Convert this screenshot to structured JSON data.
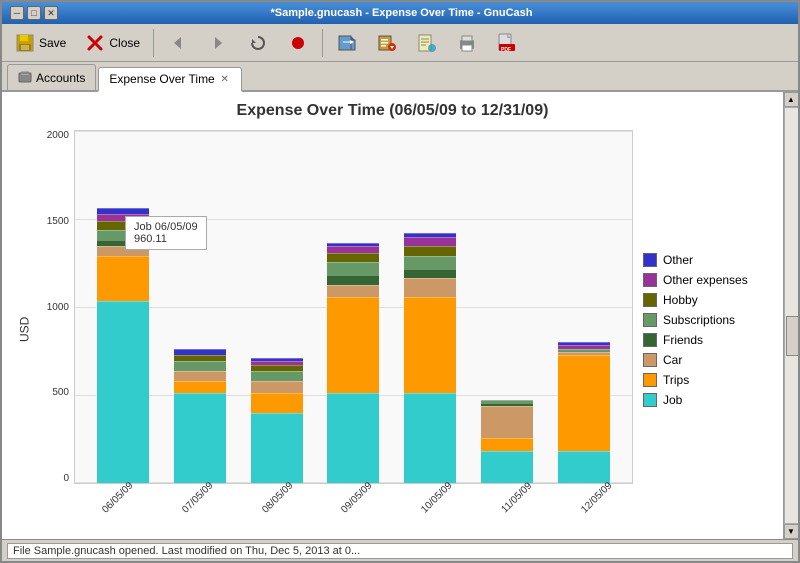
{
  "window": {
    "title": "*Sample.gnucash - Expense Over Time - GnuCash",
    "controls": [
      "minimize",
      "restore",
      "close"
    ]
  },
  "toolbar": {
    "buttons": [
      {
        "id": "save",
        "label": "Save",
        "icon": "save-icon"
      },
      {
        "id": "close",
        "label": "Close",
        "icon": "close-icon"
      },
      {
        "id": "back",
        "label": "",
        "icon": "back-icon"
      },
      {
        "id": "forward",
        "label": "",
        "icon": "forward-icon"
      },
      {
        "id": "refresh",
        "label": "",
        "icon": "refresh-icon"
      },
      {
        "id": "record",
        "label": "",
        "icon": "record-icon"
      },
      {
        "id": "import",
        "label": "",
        "icon": "import-icon"
      },
      {
        "id": "export",
        "label": "",
        "icon": "export-icon"
      },
      {
        "id": "report",
        "label": "",
        "icon": "report-icon"
      },
      {
        "id": "print",
        "label": "",
        "icon": "print-icon"
      },
      {
        "id": "pdf",
        "label": "",
        "icon": "pdf-icon"
      }
    ]
  },
  "tabs": [
    {
      "id": "accounts",
      "label": "Accounts",
      "icon": "accounts-icon",
      "closable": false,
      "active": false
    },
    {
      "id": "expense-over-time",
      "label": "Expense Over Time",
      "icon": null,
      "closable": true,
      "active": true
    }
  ],
  "chart": {
    "title": "Expense Over Time (06/05/09 to 12/31/09)",
    "y_axis_label": "USD",
    "y_ticks": [
      "2000",
      "1500",
      "1000",
      "500",
      "0"
    ],
    "x_ticks": [
      "06/05/09",
      "07/05/09",
      "08/05/09",
      "09/05/09",
      "10/05/09",
      "11/05/09",
      "12/05/09"
    ],
    "tooltip": {
      "line1": "Job 06/05/09",
      "line2": "960.11"
    },
    "legend": [
      {
        "label": "Other",
        "color": "#3333cc"
      },
      {
        "label": "Other expenses",
        "color": "#993399"
      },
      {
        "label": "Hobby",
        "color": "#666600"
      },
      {
        "label": "Subscriptions",
        "color": "#669966"
      },
      {
        "label": "Friends",
        "color": "#336633"
      },
      {
        "label": "Car",
        "color": "#cc9966"
      },
      {
        "label": "Trips",
        "color": "#ff9900"
      },
      {
        "label": "Job",
        "color": "#33cccc"
      }
    ],
    "bars": [
      {
        "x": "06/05/09",
        "segments": [
          {
            "category": "Job",
            "color": "#33cccc",
            "height_pct": 57
          },
          {
            "category": "Trips",
            "color": "#ff9900",
            "height_pct": 14
          },
          {
            "category": "Car",
            "color": "#cc9966",
            "height_pct": 3
          },
          {
            "category": "Friends",
            "color": "#336633",
            "height_pct": 2
          },
          {
            "category": "Subscriptions",
            "color": "#669966",
            "height_pct": 3
          },
          {
            "category": "Hobby",
            "color": "#666600",
            "height_pct": 3
          },
          {
            "category": "Other expenses",
            "color": "#993399",
            "height_pct": 2
          },
          {
            "category": "Other",
            "color": "#3333cc",
            "height_pct": 2
          }
        ],
        "total_pct": 86
      },
      {
        "x": "07/05/09",
        "segments": [
          {
            "category": "Job",
            "color": "#33cccc",
            "height_pct": 28
          },
          {
            "category": "Trips",
            "color": "#ff9900",
            "height_pct": 4
          },
          {
            "category": "Car",
            "color": "#cc9966",
            "height_pct": 3
          },
          {
            "category": "Subscriptions",
            "color": "#669966",
            "height_pct": 3
          },
          {
            "category": "Hobby",
            "color": "#666600",
            "height_pct": 2
          },
          {
            "category": "Other",
            "color": "#3333cc",
            "height_pct": 2
          }
        ],
        "total_pct": 42
      },
      {
        "x": "08/05/09",
        "segments": [
          {
            "category": "Job",
            "color": "#33cccc",
            "height_pct": 22
          },
          {
            "category": "Trips",
            "color": "#ff9900",
            "height_pct": 6
          },
          {
            "category": "Car",
            "color": "#cc9966",
            "height_pct": 4
          },
          {
            "category": "Subscriptions",
            "color": "#669966",
            "height_pct": 3
          },
          {
            "category": "Hobby",
            "color": "#666600",
            "height_pct": 2
          },
          {
            "category": "Other expenses",
            "color": "#993399",
            "height_pct": 1
          },
          {
            "category": "Other",
            "color": "#3333cc",
            "height_pct": 1
          }
        ],
        "total_pct": 32
      },
      {
        "x": "09/05/09",
        "segments": [
          {
            "category": "Job",
            "color": "#33cccc",
            "height_pct": 28
          },
          {
            "category": "Trips",
            "color": "#ff9900",
            "height_pct": 30
          },
          {
            "category": "Car",
            "color": "#cc9966",
            "height_pct": 4
          },
          {
            "category": "Friends",
            "color": "#336633",
            "height_pct": 3
          },
          {
            "category": "Subscriptions",
            "color": "#669966",
            "height_pct": 4
          },
          {
            "category": "Hobby",
            "color": "#666600",
            "height_pct": 3
          },
          {
            "category": "Other expenses",
            "color": "#993399",
            "height_pct": 2
          },
          {
            "category": "Other",
            "color": "#3333cc",
            "height_pct": 1
          }
        ],
        "total_pct": 75
      },
      {
        "x": "10/05/09",
        "segments": [
          {
            "category": "Job",
            "color": "#33cccc",
            "height_pct": 28
          },
          {
            "category": "Trips",
            "color": "#ff9900",
            "height_pct": 30
          },
          {
            "category": "Car",
            "color": "#cc9966",
            "height_pct": 6
          },
          {
            "category": "Friends",
            "color": "#336633",
            "height_pct": 3
          },
          {
            "category": "Subscriptions",
            "color": "#669966",
            "height_pct": 4
          },
          {
            "category": "Hobby",
            "color": "#666600",
            "height_pct": 3
          },
          {
            "category": "Other expenses",
            "color": "#993399",
            "height_pct": 3
          },
          {
            "category": "Other",
            "color": "#3333cc",
            "height_pct": 1
          }
        ],
        "total_pct": 78
      },
      {
        "x": "11/05/09",
        "segments": [
          {
            "category": "Job",
            "color": "#33cccc",
            "height_pct": 10
          },
          {
            "category": "Trips",
            "color": "#ff9900",
            "height_pct": 4
          },
          {
            "category": "Car",
            "color": "#cc9966",
            "height_pct": 10
          },
          {
            "category": "Friends",
            "color": "#336633",
            "height_pct": 1
          },
          {
            "category": "Subscriptions",
            "color": "#669966",
            "height_pct": 1
          }
        ],
        "total_pct": 26
      },
      {
        "x": "12/05/09",
        "segments": [
          {
            "category": "Job",
            "color": "#33cccc",
            "height_pct": 10
          },
          {
            "category": "Trips",
            "color": "#ff9900",
            "height_pct": 30
          },
          {
            "category": "Car",
            "color": "#cc9966",
            "height_pct": 1
          },
          {
            "category": "Subscriptions",
            "color": "#669966",
            "height_pct": 1
          },
          {
            "category": "Other expenses",
            "color": "#993399",
            "height_pct": 1
          },
          {
            "category": "Other",
            "color": "#3333cc",
            "height_pct": 1
          }
        ],
        "total_pct": 42
      }
    ]
  },
  "status_bar": {
    "text": "File Sample.gnucash opened. Last modified on Thu, Dec  5, 2013 at 0..."
  }
}
